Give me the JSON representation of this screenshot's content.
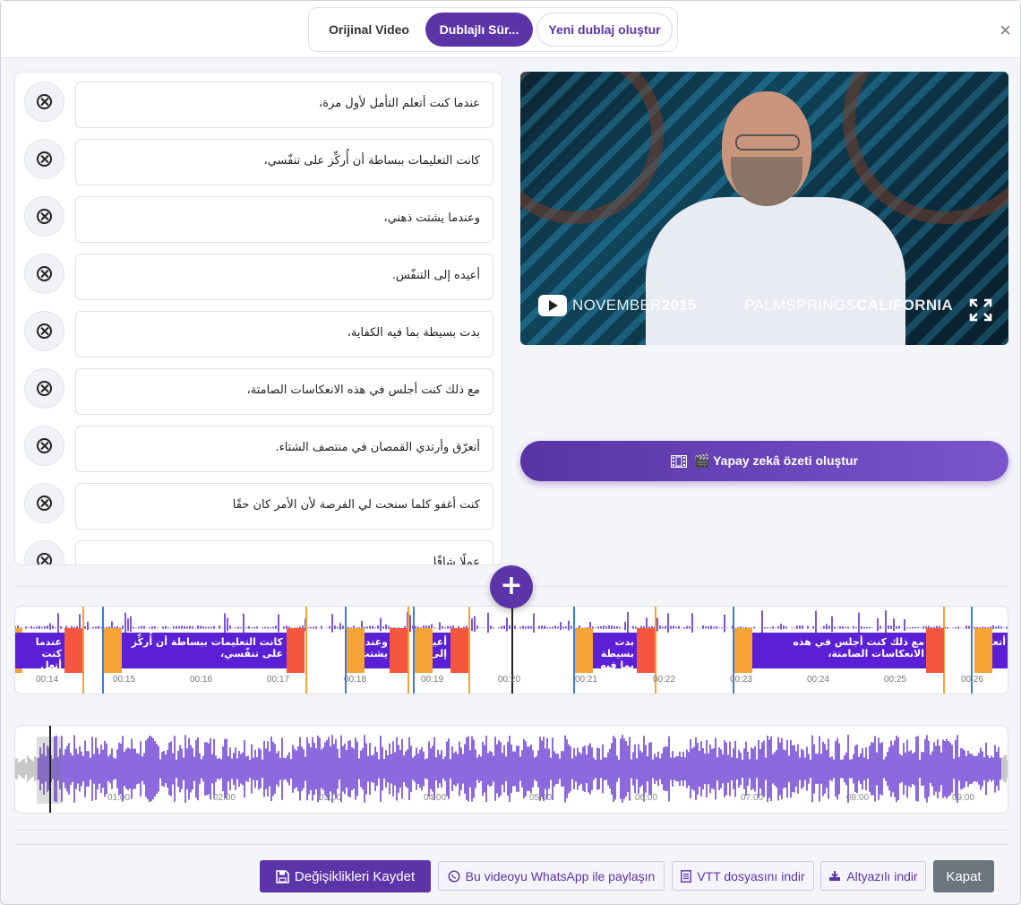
{
  "tabs": {
    "original": "Orijinal Video",
    "dubbed": "Dublajlı Sür...",
    "new_dub": "Yeni dublaj oluştur"
  },
  "close_symbol": "×",
  "segments": [
    "عندما كنت أتعلم التأمل لأول مرة،",
    "كانت التعليمات ببساطة أن أُركِّز على تنفّسي،",
    "وعندما يشتت ذهني،",
    "أعيده إلى التنفّس.",
    "بدت بسيطة بما فيه الكفاية،",
    "مع ذلك كنت أجلس في هذه الانعكاسات الصامتة،",
    "أتعرّق وأرتدي القمصان في منتصف الشتاء.",
    "كنت أغفو كلما سنحت لي الفرصة لأن الأمر كان حقًا",
    "عملًا شاقًا"
  ],
  "video": {
    "caption_left_a": "NOVEMBER",
    "caption_left_b": "2015",
    "caption_right_a": "PALMSPRINGS",
    "caption_right_b": "CALIFORNIA"
  },
  "ai_button": "🎬 Yapay zekâ özeti oluştur",
  "add_symbol": "+",
  "timeline": {
    "ticks": [
      "00:14",
      "00:15",
      "00:16",
      "00:17",
      "00:18",
      "00:19",
      "00:20",
      "00:21",
      "00:22",
      "00:23",
      "00:24",
      "00:25",
      "00:26"
    ],
    "labels": [
      "كانت التعليمات ببساطة أن أُركِّز على تنفّسي،",
      "عندما كنت أتعل",
      "وعندما يشتت",
      "أعيده إلى",
      "بدت بسيطة بما فيه الكفاية،",
      "مع ذلك كنت أجلس في هذه الانعكاسات الصامتة،",
      "أتعرّق"
    ]
  },
  "overview": {
    "ticks": [
      "01:00",
      "02:00",
      "03:00",
      "04:00",
      "05:00",
      "06:00",
      "07:00",
      "08:00",
      "09:00"
    ]
  },
  "buttons": {
    "save": "Değişiklikleri Kaydet",
    "whatsapp": "Bu videoyu WhatsApp ile paylaşın",
    "vtt": "VTT dosyasını indir",
    "subtitled": "Altyazılı indir",
    "close": "Kapat"
  },
  "colors": {
    "accent": "#5b34a8",
    "label_bg": "#5b1fd6",
    "handle_start": "#f5a337",
    "handle_end": "#f4573d",
    "wave": "#5b2ad0"
  }
}
